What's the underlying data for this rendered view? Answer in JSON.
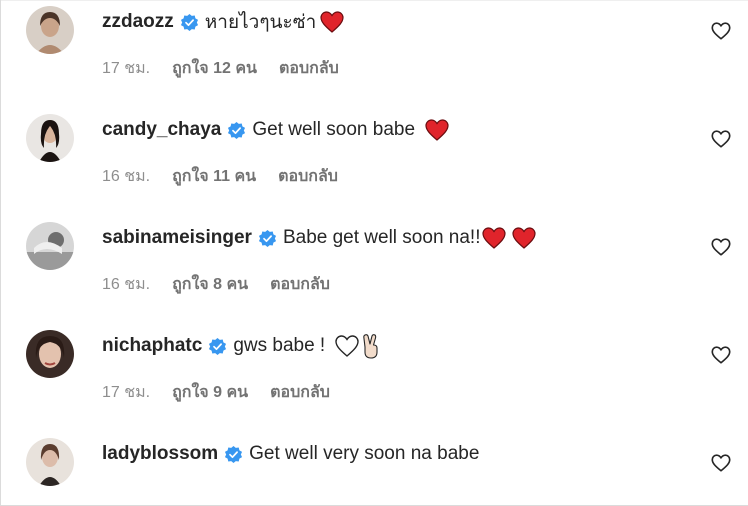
{
  "comments": [
    {
      "username": "zzdaozz",
      "text": "หายไวๆนะซ่า",
      "emojis": [
        "red-heart"
      ],
      "time": "17 ชม.",
      "likes": "ถูกใจ 12 คน",
      "reply": "ตอบกลับ",
      "avatar_color": "#c9a48a"
    },
    {
      "username": "candy_chaya",
      "text": "Get well soon babe",
      "emojis": [
        "red-heart"
      ],
      "time": "16 ชม.",
      "likes": "ถูกใจ 11 คน",
      "reply": "ตอบกลับ",
      "avatar_color": "#3a2a26"
    },
    {
      "username": "sabinameisinger",
      "text": "Babe get well soon na!!",
      "emojis": [
        "red-heart",
        "red-heart"
      ],
      "time": "16 ชม.",
      "likes": "ถูกใจ 8 คน",
      "reply": "ตอบกลับ",
      "avatar_color": "#bdbdbd"
    },
    {
      "username": "nichaphatc",
      "text": "gws babe !",
      "emojis": [
        "white-heart",
        "victory-hand"
      ],
      "time": "17 ชม.",
      "likes": "ถูกใจ 9 คน",
      "reply": "ตอบกลับ",
      "avatar_color": "#7a5a4e"
    },
    {
      "username": "ladyblossom",
      "text": "Get well very soon na babe",
      "emojis": [],
      "time": "",
      "likes": "",
      "reply": "",
      "avatar_color": "#cdb6a8"
    }
  ],
  "colors": {
    "verified": "#3897f0",
    "heart": "#e0242b",
    "muted": "#8e8e8e"
  }
}
